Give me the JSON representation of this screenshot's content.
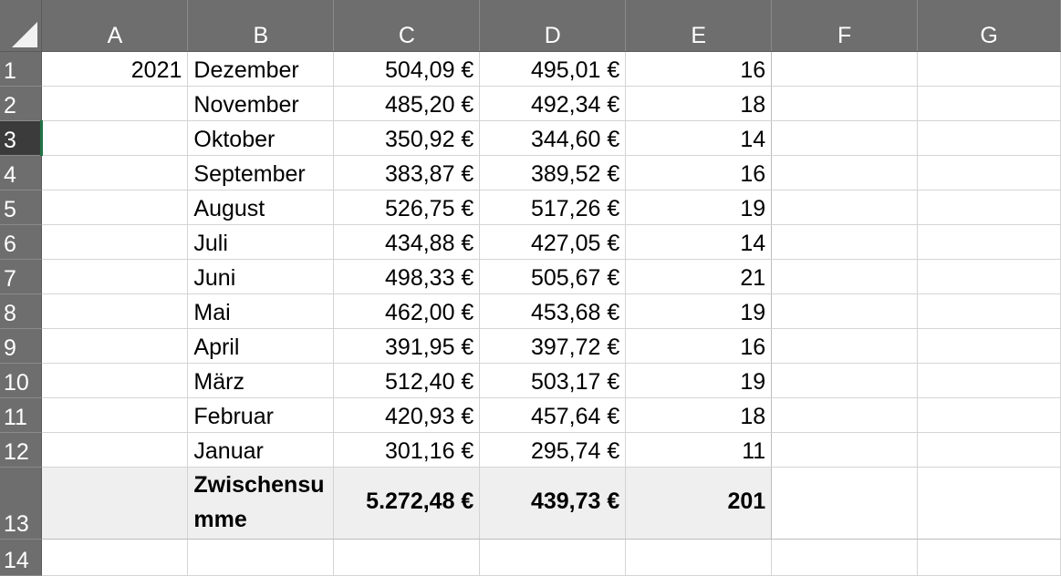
{
  "columns": [
    "A",
    "B",
    "C",
    "D",
    "E",
    "F",
    "G"
  ],
  "rows": [
    {
      "num": "1",
      "a": "2021",
      "b": "Dezember",
      "c": "504,09 €",
      "d": "495,01 €",
      "e": "16"
    },
    {
      "num": "2",
      "a": "",
      "b": "November",
      "c": "485,20 €",
      "d": "492,34 €",
      "e": "18"
    },
    {
      "num": "3",
      "a": "",
      "b": "Oktober",
      "c": "350,92 €",
      "d": "344,60 €",
      "e": "14"
    },
    {
      "num": "4",
      "a": "",
      "b": "September",
      "c": "383,87 €",
      "d": "389,52 €",
      "e": "16"
    },
    {
      "num": "5",
      "a": "",
      "b": "August",
      "c": "526,75 €",
      "d": "517,26 €",
      "e": "19"
    },
    {
      "num": "6",
      "a": "",
      "b": "Juli",
      "c": "434,88 €",
      "d": "427,05 €",
      "e": "14"
    },
    {
      "num": "7",
      "a": "",
      "b": "Juni",
      "c": "498,33 €",
      "d": "505,67 €",
      "e": "21"
    },
    {
      "num": "8",
      "a": "",
      "b": "Mai",
      "c": "462,00 €",
      "d": "453,68 €",
      "e": "19"
    },
    {
      "num": "9",
      "a": "",
      "b": "April",
      "c": "391,95 €",
      "d": "397,72 €",
      "e": "16"
    },
    {
      "num": "10",
      "a": "",
      "b": "März",
      "c": "512,40 €",
      "d": "503,17 €",
      "e": "19"
    },
    {
      "num": "11",
      "a": "",
      "b": "Februar",
      "c": "420,93 €",
      "d": "457,64 €",
      "e": "18"
    },
    {
      "num": "12",
      "a": "",
      "b": "Januar",
      "c": "301,16 €",
      "d": "295,74 €",
      "e": "11"
    }
  ],
  "total": {
    "num": "13",
    "b": "Zwischensumme",
    "c": "5.272,48 €",
    "d": "439,73 €",
    "e": "201"
  },
  "empty_row": {
    "num": "14"
  },
  "active_row": "3",
  "colors": {
    "header_bg": "#6e6e6e",
    "active_row_header_bg": "#3b3b3b",
    "active_marker": "#217346",
    "total_row_bg": "#efefef"
  }
}
